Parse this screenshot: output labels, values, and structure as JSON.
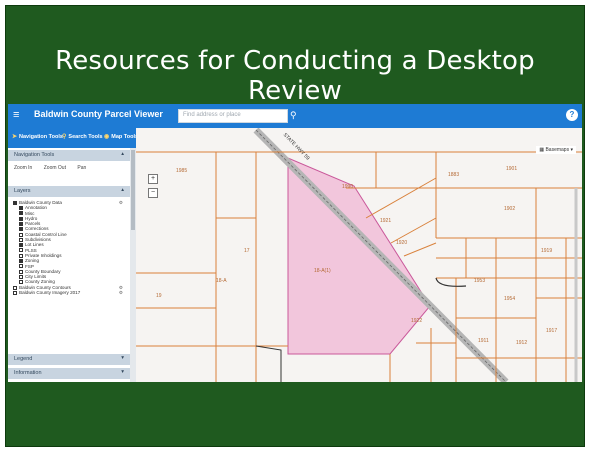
{
  "slide": {
    "title": "Resources for Conducting a Desktop Review"
  },
  "app": {
    "title": "Baldwin County Parcel Viewer",
    "search_placeholder": "Find address or place",
    "help_label": "?"
  },
  "toolbar": {
    "items": [
      {
        "label": "Navigation Tools",
        "icon": "compass-icon"
      },
      {
        "label": "Search Tools",
        "icon": "magnify-icon"
      },
      {
        "label": "Map Tools",
        "icon": "map-icon"
      }
    ]
  },
  "sidebar": {
    "panels": [
      {
        "label": "Navigation Tools"
      },
      {
        "label": "Layers"
      },
      {
        "label": "Legend"
      },
      {
        "label": "Information"
      }
    ],
    "nav_tools": [
      "Zoom In",
      "Zoom Out",
      "Pan"
    ],
    "layers": [
      {
        "label": "Baldwin County Data",
        "checked": true,
        "indent": 0
      },
      {
        "label": "Annotation",
        "checked": true,
        "indent": 1
      },
      {
        "label": "Misc",
        "checked": true,
        "indent": 1
      },
      {
        "label": "Hydro",
        "checked": true,
        "indent": 1
      },
      {
        "label": "Parcels",
        "checked": true,
        "indent": 1
      },
      {
        "label": "Corrections",
        "checked": true,
        "indent": 1
      },
      {
        "label": "Coastal Control Line",
        "checked": false,
        "indent": 1
      },
      {
        "label": "Subdivisions",
        "checked": false,
        "indent": 1
      },
      {
        "label": "Lot Lines",
        "checked": true,
        "indent": 1
      },
      {
        "label": "PLSS",
        "checked": false,
        "indent": 1
      },
      {
        "label": "Private Inholdings",
        "checked": false,
        "indent": 1
      },
      {
        "label": "Zoning",
        "checked": true,
        "indent": 1
      },
      {
        "label": "FSP",
        "checked": false,
        "indent": 1
      },
      {
        "label": "County Boundary",
        "checked": false,
        "indent": 1
      },
      {
        "label": "City Limits",
        "checked": false,
        "indent": 1
      },
      {
        "label": "County Zoning",
        "checked": false,
        "indent": 1
      },
      {
        "label": "Baldwin County Contours",
        "checked": false,
        "indent": 0
      },
      {
        "label": "Baldwin County Imagery 2017",
        "checked": false,
        "indent": 0
      }
    ]
  },
  "map": {
    "basemap_label": "Basemaps",
    "zoom_in": "+",
    "zoom_out": "−",
    "road_label": "STATE HWY 59",
    "parcel_labels": [
      "1985",
      "17",
      "19",
      "18-A",
      "18-A(1)",
      "1990",
      "1921",
      "1920",
      "1922",
      "1883",
      "1901",
      "1902",
      "1953",
      "1954",
      "1911",
      "1912",
      "1919",
      "1917"
    ],
    "highlight_color": "#f2c6dc",
    "parcel_line_color": "#d9813b"
  }
}
